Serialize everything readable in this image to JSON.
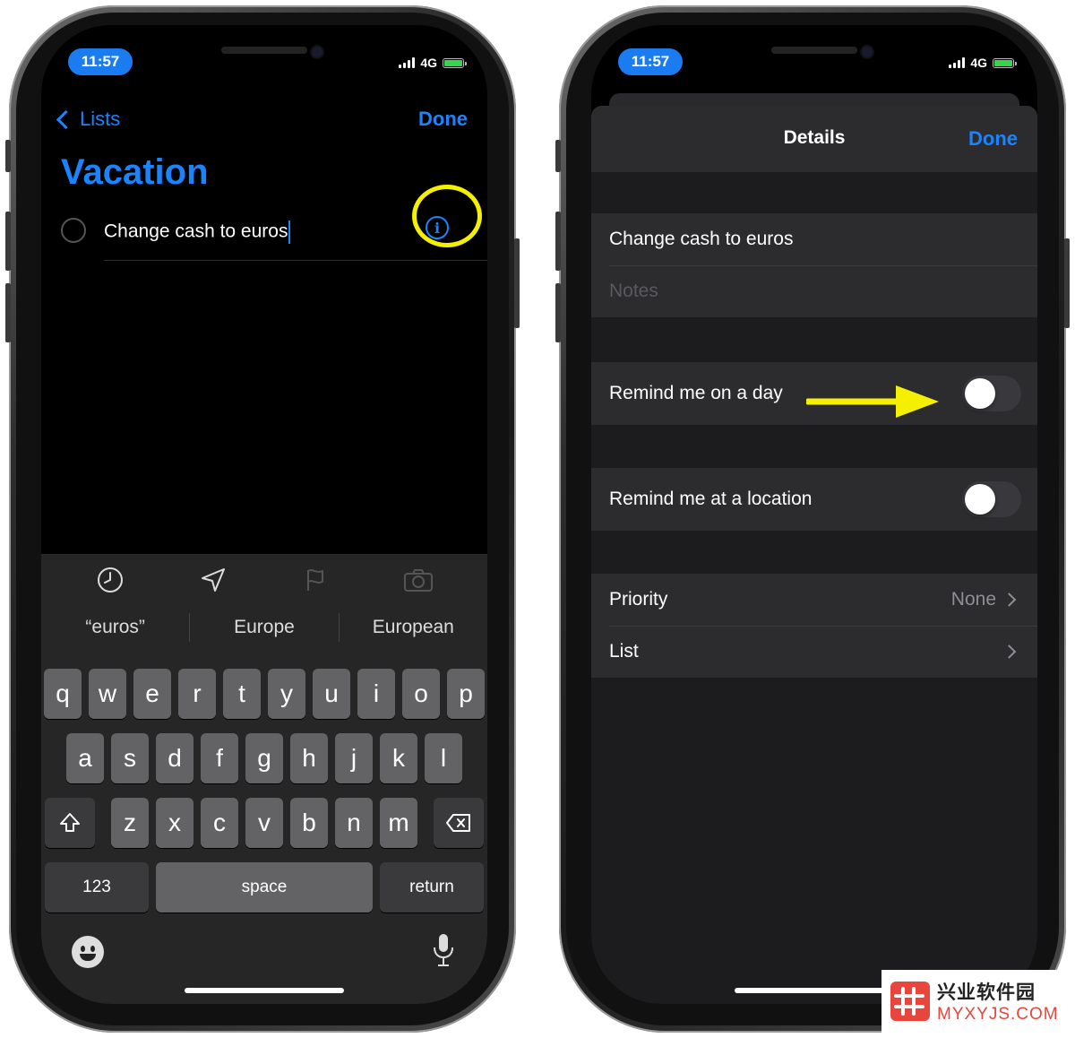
{
  "status_bar": {
    "time": "11:57",
    "network": "4G"
  },
  "left_screen": {
    "back_label": "Lists",
    "done_label": "Done",
    "list_title": "Vacation",
    "task_text": "Change cash to euros",
    "suggestions": [
      "“euros”",
      "Europe",
      "European"
    ],
    "keyboard": {
      "row1": [
        "q",
        "w",
        "e",
        "r",
        "t",
        "y",
        "u",
        "i",
        "o",
        "p"
      ],
      "row2": [
        "a",
        "s",
        "d",
        "f",
        "g",
        "h",
        "j",
        "k",
        "l"
      ],
      "row3": [
        "z",
        "x",
        "c",
        "v",
        "b",
        "n",
        "m"
      ],
      "numbers_label": "123",
      "space_label": "space",
      "return_label": "return"
    },
    "toolbar_icons": [
      "clock-icon",
      "location-arrow-icon",
      "flag-icon",
      "camera-icon"
    ],
    "highlight_color": "#f5f000"
  },
  "right_screen": {
    "title": "Details",
    "done_label": "Done",
    "task_title": "Change cash to euros",
    "notes_placeholder": "Notes",
    "remind_day_label": "Remind me on a day",
    "remind_day_on": false,
    "remind_location_label": "Remind me at a location",
    "remind_location_on": false,
    "priority_label": "Priority",
    "priority_value": "None",
    "list_label": "List"
  },
  "watermark": {
    "name": "兴业软件园",
    "url": "MYXYJS.COM"
  },
  "colors": {
    "accent": "#1a84ff",
    "annotation": "#f5f000",
    "background": "#000000"
  }
}
